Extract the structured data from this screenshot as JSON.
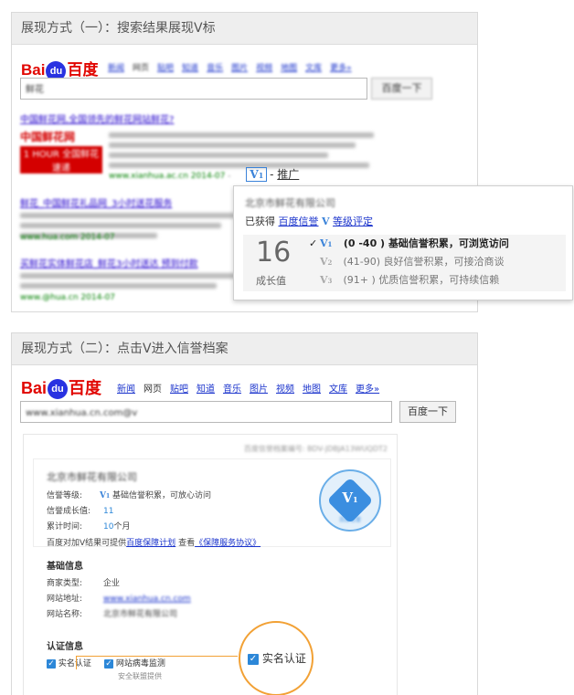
{
  "panel1": {
    "title": "展现方式（一）：搜索结果展现V标",
    "nav": [
      "新闻",
      "网页",
      "贴吧",
      "知道",
      "音乐",
      "图片",
      "视频",
      "地图",
      "文库",
      "更多»"
    ],
    "search_value": "鲜花",
    "search_button": "百度一下",
    "result1_title": "中国鲜花网,全国领先的鲜花网站鲜花?",
    "result1_badge": "中国鲜花网",
    "result1_banner": "1 HOUR 全国鲜花速递",
    "result1_url": "www.xianhua.ac.cn 2014-07",
    "v_badge": "V",
    "promo": "推广",
    "result2_title": "鲜花_中国鲜花礼品网_3小时送花服务",
    "result2_url": "www.hua.com 2014-07",
    "result3_title": "买鲜花实体鲜花店_鲜花3小时送达 预到付款",
    "result3_url": "www.@hua.cn 2014-07"
  },
  "popup": {
    "company": "北京市鲜花有限公司",
    "obtained": "已获得",
    "trust_link": "百度信誉",
    "grade_link": "等级评定",
    "score": "16",
    "score_label": "成长值",
    "levels": [
      {
        "check": "✓",
        "name": "V1",
        "range": "(0 -40 )",
        "desc": "基础信誉积累，可浏览访问"
      },
      {
        "check": "",
        "name": "V2",
        "range": "(41-90)",
        "desc": "良好信誉积累，可接洽商谈"
      },
      {
        "check": "",
        "name": "V3",
        "range": "(91+ )",
        "desc": "优质信誉积累，可持续信赖"
      }
    ]
  },
  "panel2": {
    "title": "展现方式（二）：点击V进入信誉档案",
    "nav": [
      "新闻",
      "网页",
      "贴吧",
      "知道",
      "音乐",
      "图片",
      "视频",
      "地图",
      "文库",
      "更多»"
    ],
    "search_value": "www.xianhua.cn.com@v",
    "search_button": "百度一下",
    "record_no": "百度信誉档案编号: BDV-JDBJA13WUQDT2",
    "company": "北京市鲜花有限公司",
    "trust_level_label": "信誉等级:",
    "trust_level_value": "基础信誉积累，可放心访问",
    "growth_label": "信誉成长值:",
    "growth_value": "11",
    "time_label": "累计时间:",
    "time_value": "10",
    "time_unit": "个月",
    "guarantee_text": "百度对加V结果可提供",
    "guarantee_link": "百度保障计划",
    "view_text": "查看",
    "protocol_link": "《保障服务协议》",
    "seal_text": "百度信誉",
    "basic_info": "基础信息",
    "merchant_type_label": "商家类型:",
    "merchant_type_value": "企业",
    "site_url_label": "网站地址:",
    "site_url_value": "www.xianhua.cn.com",
    "site_name_label": "网站名称:",
    "site_name_value": "北京市鲜花有限公司",
    "cert_info": "认证信息",
    "cert1": "实名认证",
    "cert2": "网站病毒监测",
    "cert2_sub": "安全联盟提供",
    "callout": "实名认证"
  },
  "colors": {
    "baidu_red": "#e10601",
    "baidu_blue": "#2932e1",
    "v_blue": "#3b83d9",
    "callout_orange": "#f2a135"
  }
}
